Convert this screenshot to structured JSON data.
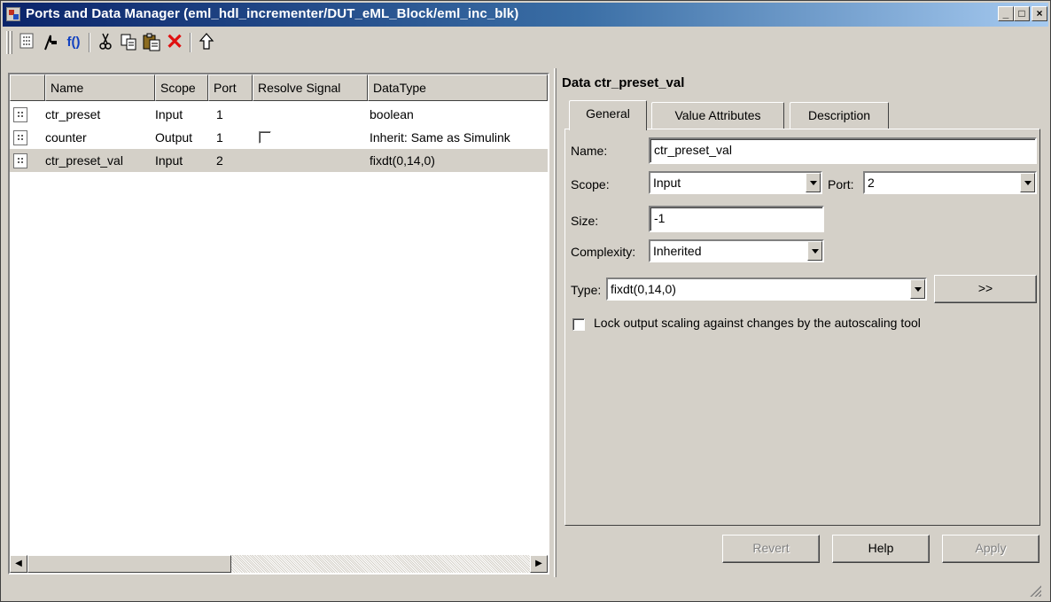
{
  "window": {
    "title": "Ports and Data Manager (eml_hdl_incrementer/DUT_eML_Block/eml_inc_blk)",
    "controls": [
      "_",
      "□",
      "×"
    ]
  },
  "toolbar": {
    "icons": [
      "add-data-icon",
      "add-event-icon",
      "function-icon",
      "cut-icon",
      "copy-icon",
      "paste-icon",
      "delete-icon",
      "up-icon"
    ],
    "function_label": "f()"
  },
  "list": {
    "columns": [
      "Name",
      "Scope",
      "Port",
      "Resolve Signal",
      "DataType"
    ],
    "rows": [
      {
        "name": "ctr_preset",
        "scope": "Input",
        "port": "1",
        "resolve": "",
        "datatype": "boolean",
        "has_checkbox": false,
        "selected": false
      },
      {
        "name": "counter",
        "scope": "Output",
        "port": "1",
        "resolve": "",
        "datatype": "Inherit: Same as Simulink",
        "has_checkbox": true,
        "selected": false
      },
      {
        "name": "ctr_preset_val",
        "scope": "Input",
        "port": "2",
        "resolve": "",
        "datatype": "fixdt(0,14,0)",
        "has_checkbox": false,
        "selected": true
      }
    ]
  },
  "details": {
    "header": "Data ctr_preset_val",
    "tabs": [
      "General",
      "Value Attributes",
      "Description"
    ],
    "active_tab": "General",
    "name_label": "Name:",
    "name_value": "ctr_preset_val",
    "scope_label": "Scope:",
    "scope_value": "Input",
    "port_label": "Port:",
    "port_value": "2",
    "size_label": "Size:",
    "size_value": "-1",
    "complexity_label": "Complexity:",
    "complexity_value": "Inherited",
    "type_label": "Type:",
    "type_value": "fixdt(0,14,0)",
    "type_button": ">>",
    "lock_label": "Lock output scaling against changes by the autoscaling tool",
    "lock_checked": false
  },
  "buttons": {
    "revert": "Revert",
    "help": "Help",
    "apply": "Apply"
  }
}
